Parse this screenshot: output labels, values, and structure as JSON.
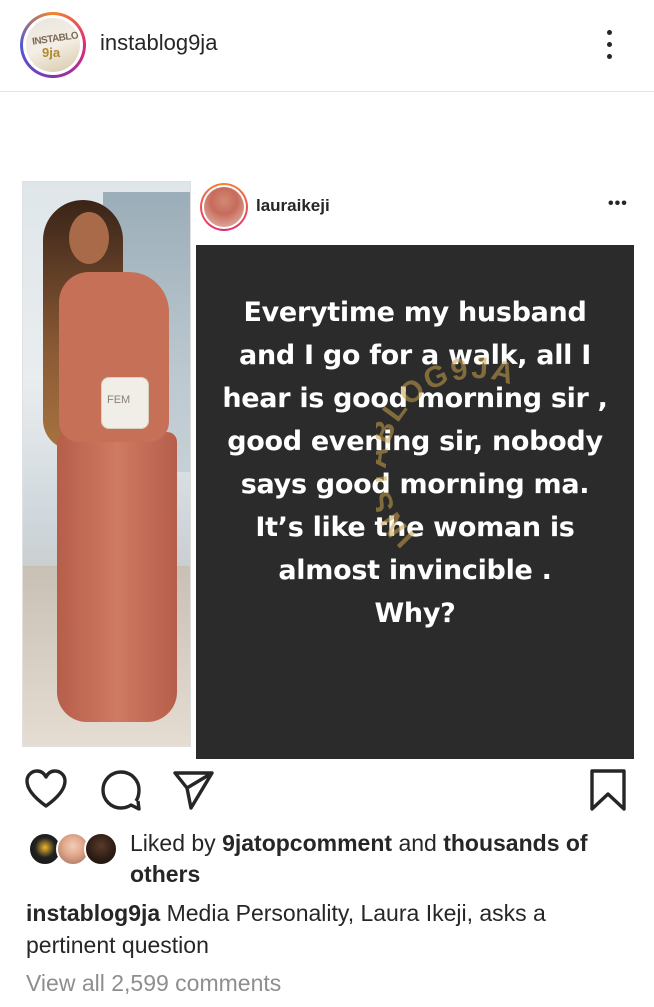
{
  "header": {
    "username": "instablog9ja",
    "avatar_text_top": "INSTABLOG",
    "avatar_text_bottom": "9ja",
    "more_icon": "more-vertical-icon"
  },
  "post": {
    "reshared_user": "lauraikeji",
    "reshared_more": "•••",
    "quote_lines": [
      "Everytime my husband",
      "and I go for a walk, all I",
      "hear is good morning sir ,",
      "good evening sir, nobody",
      "says good morning ma.",
      "It’s like the woman is",
      "almost invincible .",
      "Why?"
    ],
    "watermark": "INSTABLOG9JA",
    "photo_bag_text": "FEM"
  },
  "actions": {
    "like_icon": "heart-icon",
    "comment_icon": "comment-bubble-icon",
    "share_icon": "paper-plane-icon",
    "save_icon": "bookmark-icon"
  },
  "likes": {
    "prefix": "Liked by",
    "user": "9jatopcomment",
    "middle": "and",
    "suffix": "thousands of others"
  },
  "caption": {
    "user": "instablog9ja",
    "text": "Media Personality, Laura Ikeji, asks a pertinent question"
  },
  "comments": {
    "label": "View all 2,599 comments"
  }
}
